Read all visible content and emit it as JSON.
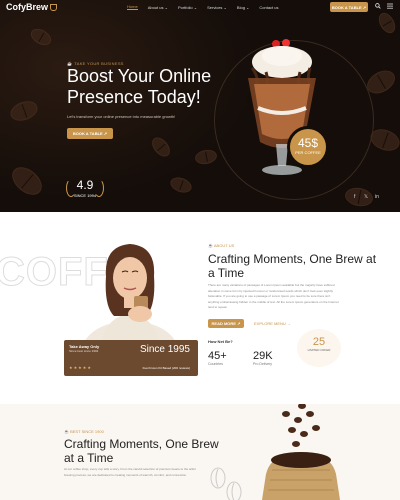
{
  "nav": {
    "logo": "CofyBrew",
    "menu": [
      "Home",
      "About us ⌄",
      "Portfolio ⌄",
      "Services ⌄",
      "Blog ⌄",
      "Contact us"
    ],
    "book_label": "BOOK A TABLE ↗",
    "search_icon": "search-icon",
    "menu_icon": "hamburger-icon"
  },
  "hero": {
    "tagline": "TAKE YOUR BUSINESS",
    "title": "Boost Your Online Presence Today!",
    "subtitle": "Let's transform your online presence into measurable growth!",
    "cta": "BOOK A TABLE ↗",
    "rating": "4.9",
    "rating_label": "SINCE 1994",
    "price": "45$",
    "price_label": "PER COFFEE",
    "social": [
      "f",
      "𝕏",
      "in"
    ]
  },
  "about": {
    "watermark": "COFFE",
    "tag": "ABOUT US",
    "title": "Crafting Moments, One Brew at a Time",
    "paragraph": "There are many variations of passages of Lorem Ipsum available but the majority have suffered alteration in some form by injected humour or randomised words which don't look even slightly believable. If you are going to use a passage of Lorem Ipsum you need to be sure there isn't anything embarrassing hidden in the middle of text. All the Lorem Ipsum generators on the Internet tend to repeat.",
    "read_more": "READ MORE ↗",
    "explore": "EXPLORE MENU →",
    "years_number": "25",
    "years_label": "LIMITED OFFER",
    "question": "How Net Be?",
    "stats": [
      {
        "value": "45+",
        "label": "Countries"
      },
      {
        "value": "29K",
        "label": "Pro Delivery"
      }
    ],
    "card": {
      "name": "Take Away Only",
      "role": "Since best since 1994",
      "year": "Since 1995",
      "stars": "★★★★★",
      "best": "Fuel brown Kit Based (200 reviews)"
    }
  },
  "bottom": {
    "tag": "BEST SINCE 1900",
    "title": "Crafting Moments, One Brew at a Time",
    "paragraph": "At our coffee shop, every cup tells a story. From the careful selection of premium beans to the artful brewing process, we are dedicated to creating moments of warmth, comfort, and connection."
  },
  "colors": {
    "accent": "#c8954a",
    "hero_bg": "#140d09",
    "card": "#6b4a30"
  }
}
